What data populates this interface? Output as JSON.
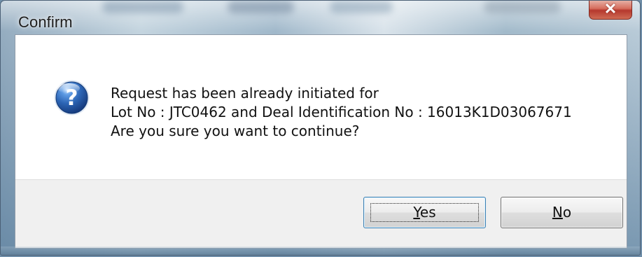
{
  "window": {
    "title": "Confirm",
    "close_icon": "✕",
    "close_icon_name": "close-icon"
  },
  "message": {
    "icon": "question-mark-icon",
    "lines": [
      "Request has been already initiated for",
      "Lot No : JTC0462 and Deal Identification No : 16013K1D03067671",
      "Are you sure you want to continue?"
    ]
  },
  "buttons": {
    "yes": "Yes",
    "no": "No"
  },
  "colors": {
    "dialog_background": "#ffffff",
    "button_area_background": "#f0f0f0",
    "close_button_red": "#c74b3e",
    "question_icon_blue": "#2f64b4"
  }
}
